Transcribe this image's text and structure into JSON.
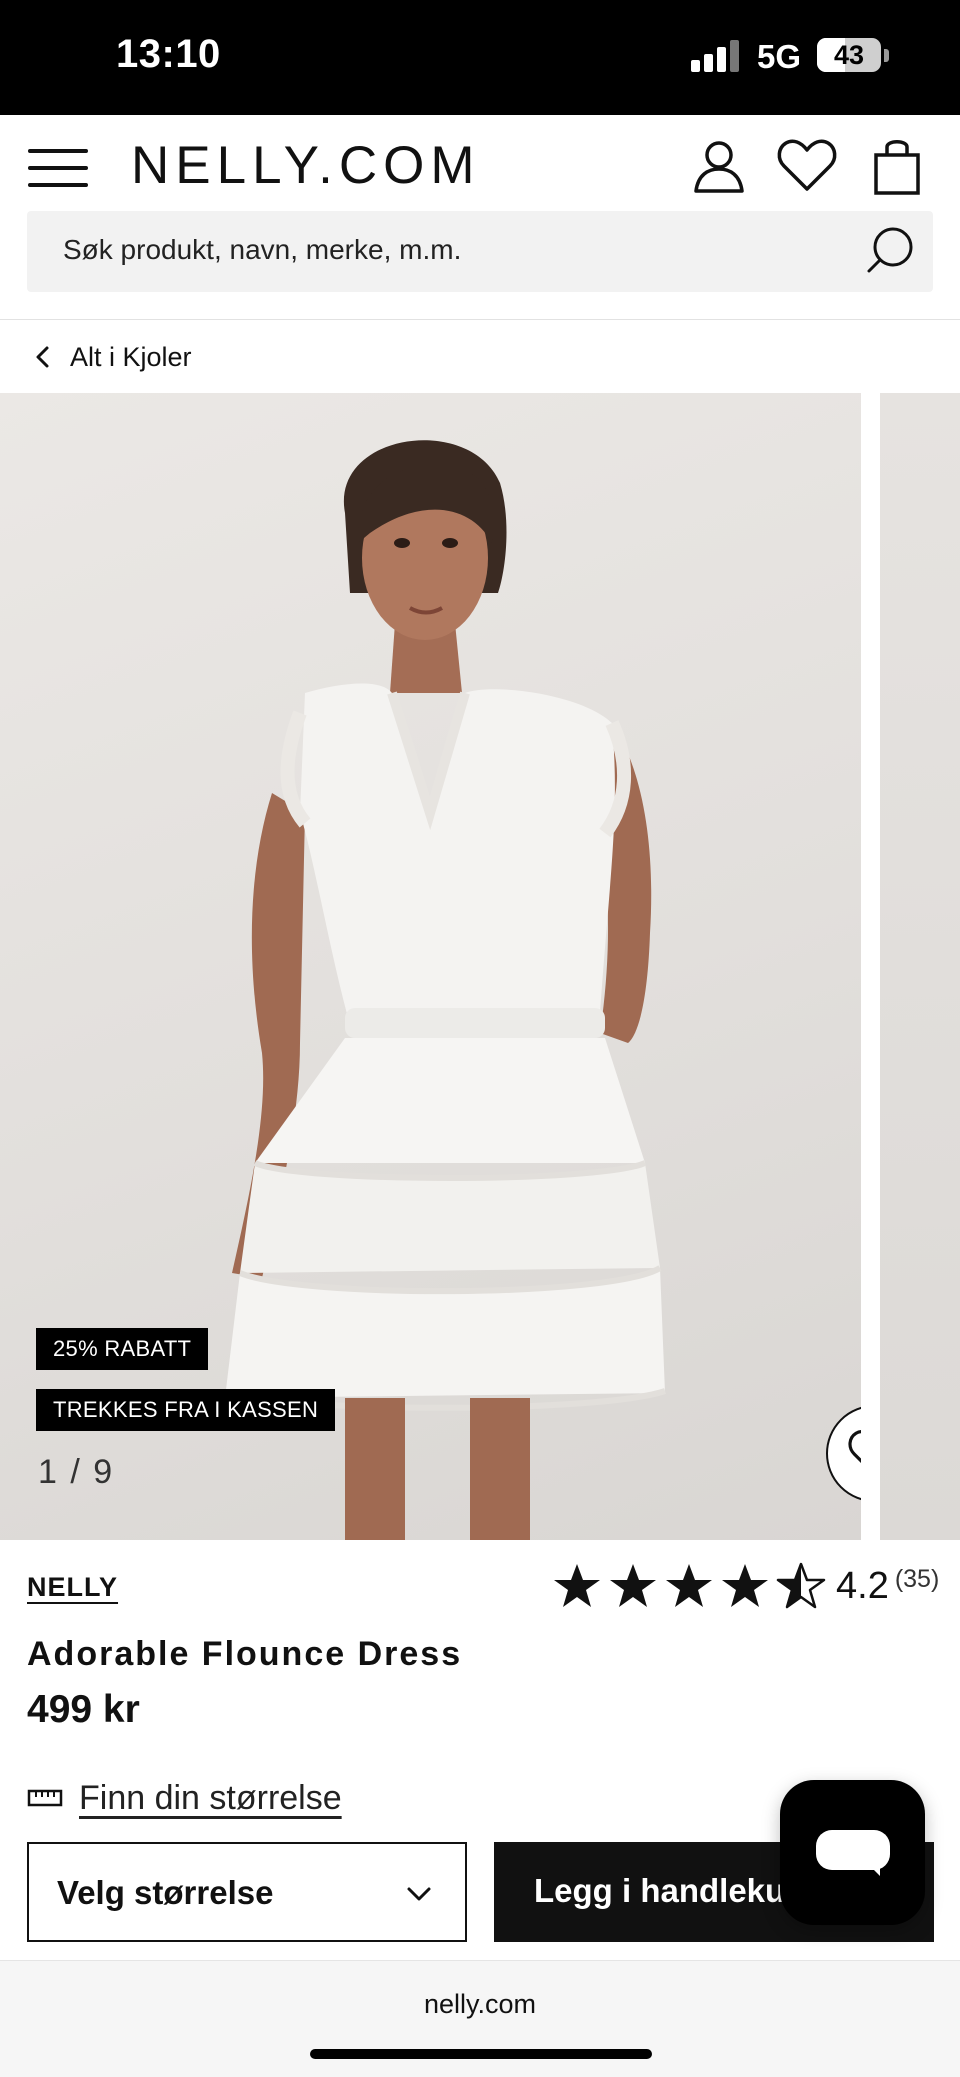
{
  "status_bar": {
    "time": "13:10",
    "network": "5G",
    "battery": "43",
    "battery_level": 0.43
  },
  "header": {
    "logo": "NELLY.COM",
    "search_placeholder": "Søk produkt, navn, merke, m.m."
  },
  "breadcrumb": {
    "label": "Alt i Kjoler"
  },
  "gallery": {
    "badges": [
      "25% RABATT",
      "TREKKES FRA I KASSEN"
    ],
    "counter": "1 / 9",
    "current": 1,
    "total": 9
  },
  "product": {
    "brand": "NELLY",
    "rating": "4.2",
    "rating_value": 4.2,
    "review_count": "(35)",
    "title": "Adorable Flounce Dress",
    "price": "499 kr",
    "size_guide": "Finn din størrelse",
    "size_select": "Velg størrelse",
    "add_to_cart": "Legg i handlekurv"
  },
  "browser": {
    "url": "nelly.com"
  },
  "icons": {
    "menu": "menu-icon",
    "account": "user-icon",
    "wishlist": "heart-icon",
    "cart": "bag-icon",
    "search": "search-icon",
    "back": "chevron-left-icon",
    "favorite": "heart-icon",
    "star": "star-icon",
    "ruler": "ruler-icon",
    "dropdown": "chevron-down-icon",
    "chat": "chat-icon"
  },
  "colors": {
    "primary": "#111111",
    "badge_bg": "#000000",
    "search_bg": "#f2f2f2",
    "photo_bg": "#e6e3e0"
  }
}
